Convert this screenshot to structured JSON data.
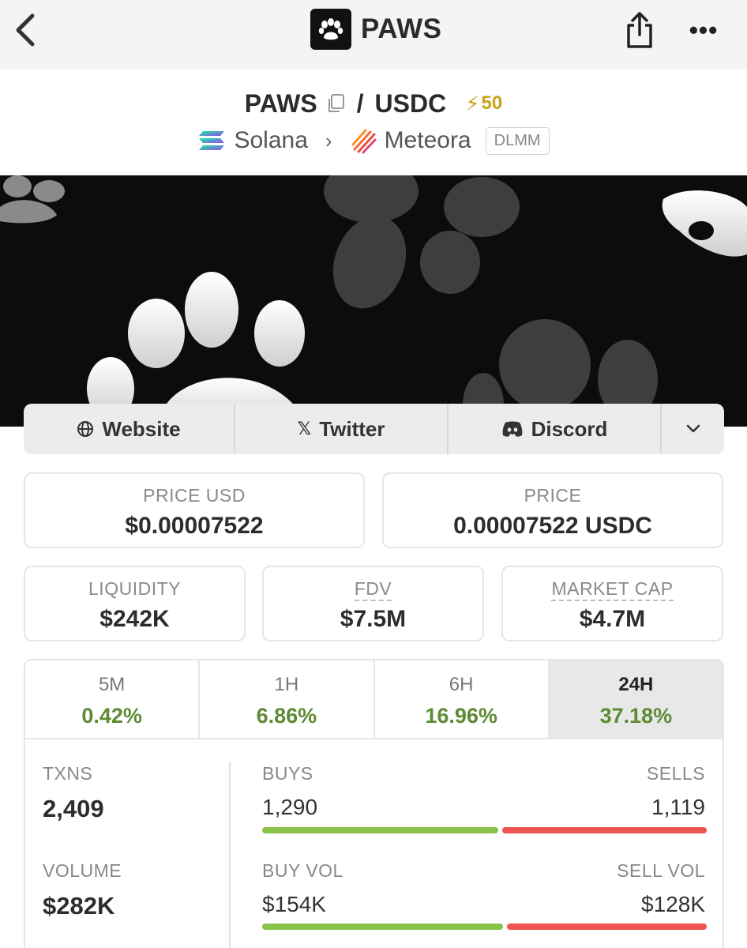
{
  "nav": {
    "back_icon": "chevron-left-icon",
    "title": "PAWS",
    "share_icon": "share-icon",
    "more_icon": "ellipsis-icon",
    "more_label": "•••"
  },
  "pair": {
    "base": "PAWS",
    "separator": "/",
    "quote": "USDC",
    "boost_icon": "⚡",
    "boost": "50",
    "chain": "Solana",
    "chevron": "›",
    "dex": "Meteora",
    "dex_tag": "DLMM"
  },
  "links": {
    "website": "Website",
    "twitter": "Twitter",
    "discord": "Discord",
    "x_glyph": "𝕏",
    "chevron": "⌄"
  },
  "price": {
    "usd_label": "PRICE USD",
    "usd_value": "$0.00007522",
    "native_label": "PRICE",
    "native_value": "0.00007522 USDC"
  },
  "metrics": {
    "liquidity_label": "LIQUIDITY",
    "liquidity_value": "$242K",
    "fdv_label": "FDV",
    "fdv_value": "$7.5M",
    "mcap_label": "MARKET CAP",
    "mcap_value": "$4.7M"
  },
  "timeframes": [
    {
      "label": "5M",
      "change": "0.42%"
    },
    {
      "label": "1H",
      "change": "6.86%"
    },
    {
      "label": "6H",
      "change": "16.96%"
    },
    {
      "label": "24H",
      "change": "37.18%"
    }
  ],
  "active_timeframe": "24H",
  "txns": {
    "txns_label": "TXNS",
    "txns_value": "2,409",
    "buys_label": "BUYS",
    "buys_value": "1,290",
    "sells_label": "SELLS",
    "sells_value": "1,119",
    "buy_share": 0.535,
    "volume_label": "VOLUME",
    "volume_value": "$282K",
    "buy_vol_label": "BUY VOL",
    "buy_vol_value": "$154K",
    "sell_vol_label": "SELL VOL",
    "sell_vol_value": "$128K",
    "buy_vol_share": 0.546
  },
  "colors": {
    "positive": "#5e8a34",
    "buy_bar": "#8bc34a",
    "sell_bar": "#ef5350",
    "boost": "#c9a21a"
  }
}
